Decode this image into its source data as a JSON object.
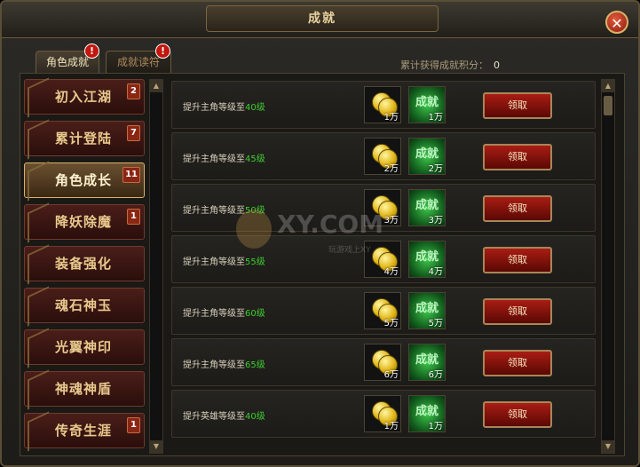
{
  "window": {
    "title": "成就"
  },
  "tabs": [
    {
      "label": "角色成就",
      "alert": "!"
    },
    {
      "label": "成就读符",
      "alert": "!"
    }
  ],
  "points": {
    "label": "累计获得成就积分：",
    "value": "0"
  },
  "categories": [
    {
      "label": "初入江湖",
      "badge": "2"
    },
    {
      "label": "累计登陆",
      "badge": "7"
    },
    {
      "label": "角色成长",
      "badge": "11"
    },
    {
      "label": "降妖除魔",
      "badge": "1"
    },
    {
      "label": "装备强化",
      "badge": ""
    },
    {
      "label": "魂石神玉",
      "badge": ""
    },
    {
      "label": "光翼神印",
      "badge": ""
    },
    {
      "label": "神魂神盾",
      "badge": ""
    },
    {
      "label": "传奇生涯",
      "badge": "1"
    }
  ],
  "achievements": [
    {
      "text": "提升主角等级至",
      "level": "40级",
      "gold": "1万",
      "reward_word": "成就",
      "reward_qty": "1万",
      "button": "领取"
    },
    {
      "text": "提升主角等级至",
      "level": "45级",
      "gold": "2万",
      "reward_word": "成就",
      "reward_qty": "2万",
      "button": "领取"
    },
    {
      "text": "提升主角等级至",
      "level": "50级",
      "gold": "3万",
      "reward_word": "成就",
      "reward_qty": "3万",
      "button": "领取"
    },
    {
      "text": "提升主角等级至",
      "level": "55级",
      "gold": "4万",
      "reward_word": "成就",
      "reward_qty": "4万",
      "button": "领取"
    },
    {
      "text": "提升主角等级至",
      "level": "60级",
      "gold": "5万",
      "reward_word": "成就",
      "reward_qty": "5万",
      "button": "领取"
    },
    {
      "text": "提升主角等级至",
      "level": "65级",
      "gold": "6万",
      "reward_word": "成就",
      "reward_qty": "6万",
      "button": "领取"
    },
    {
      "text": "提升英雄等级至",
      "level": "40级",
      "gold": "1万",
      "reward_word": "成就",
      "reward_qty": "1万",
      "button": "领取"
    }
  ],
  "watermark": {
    "text": "XY.COM",
    "sub": "玩游戏上XY"
  },
  "close": {
    "glyph": "✕"
  },
  "scroll": {
    "up": "▲",
    "down": "▼"
  }
}
